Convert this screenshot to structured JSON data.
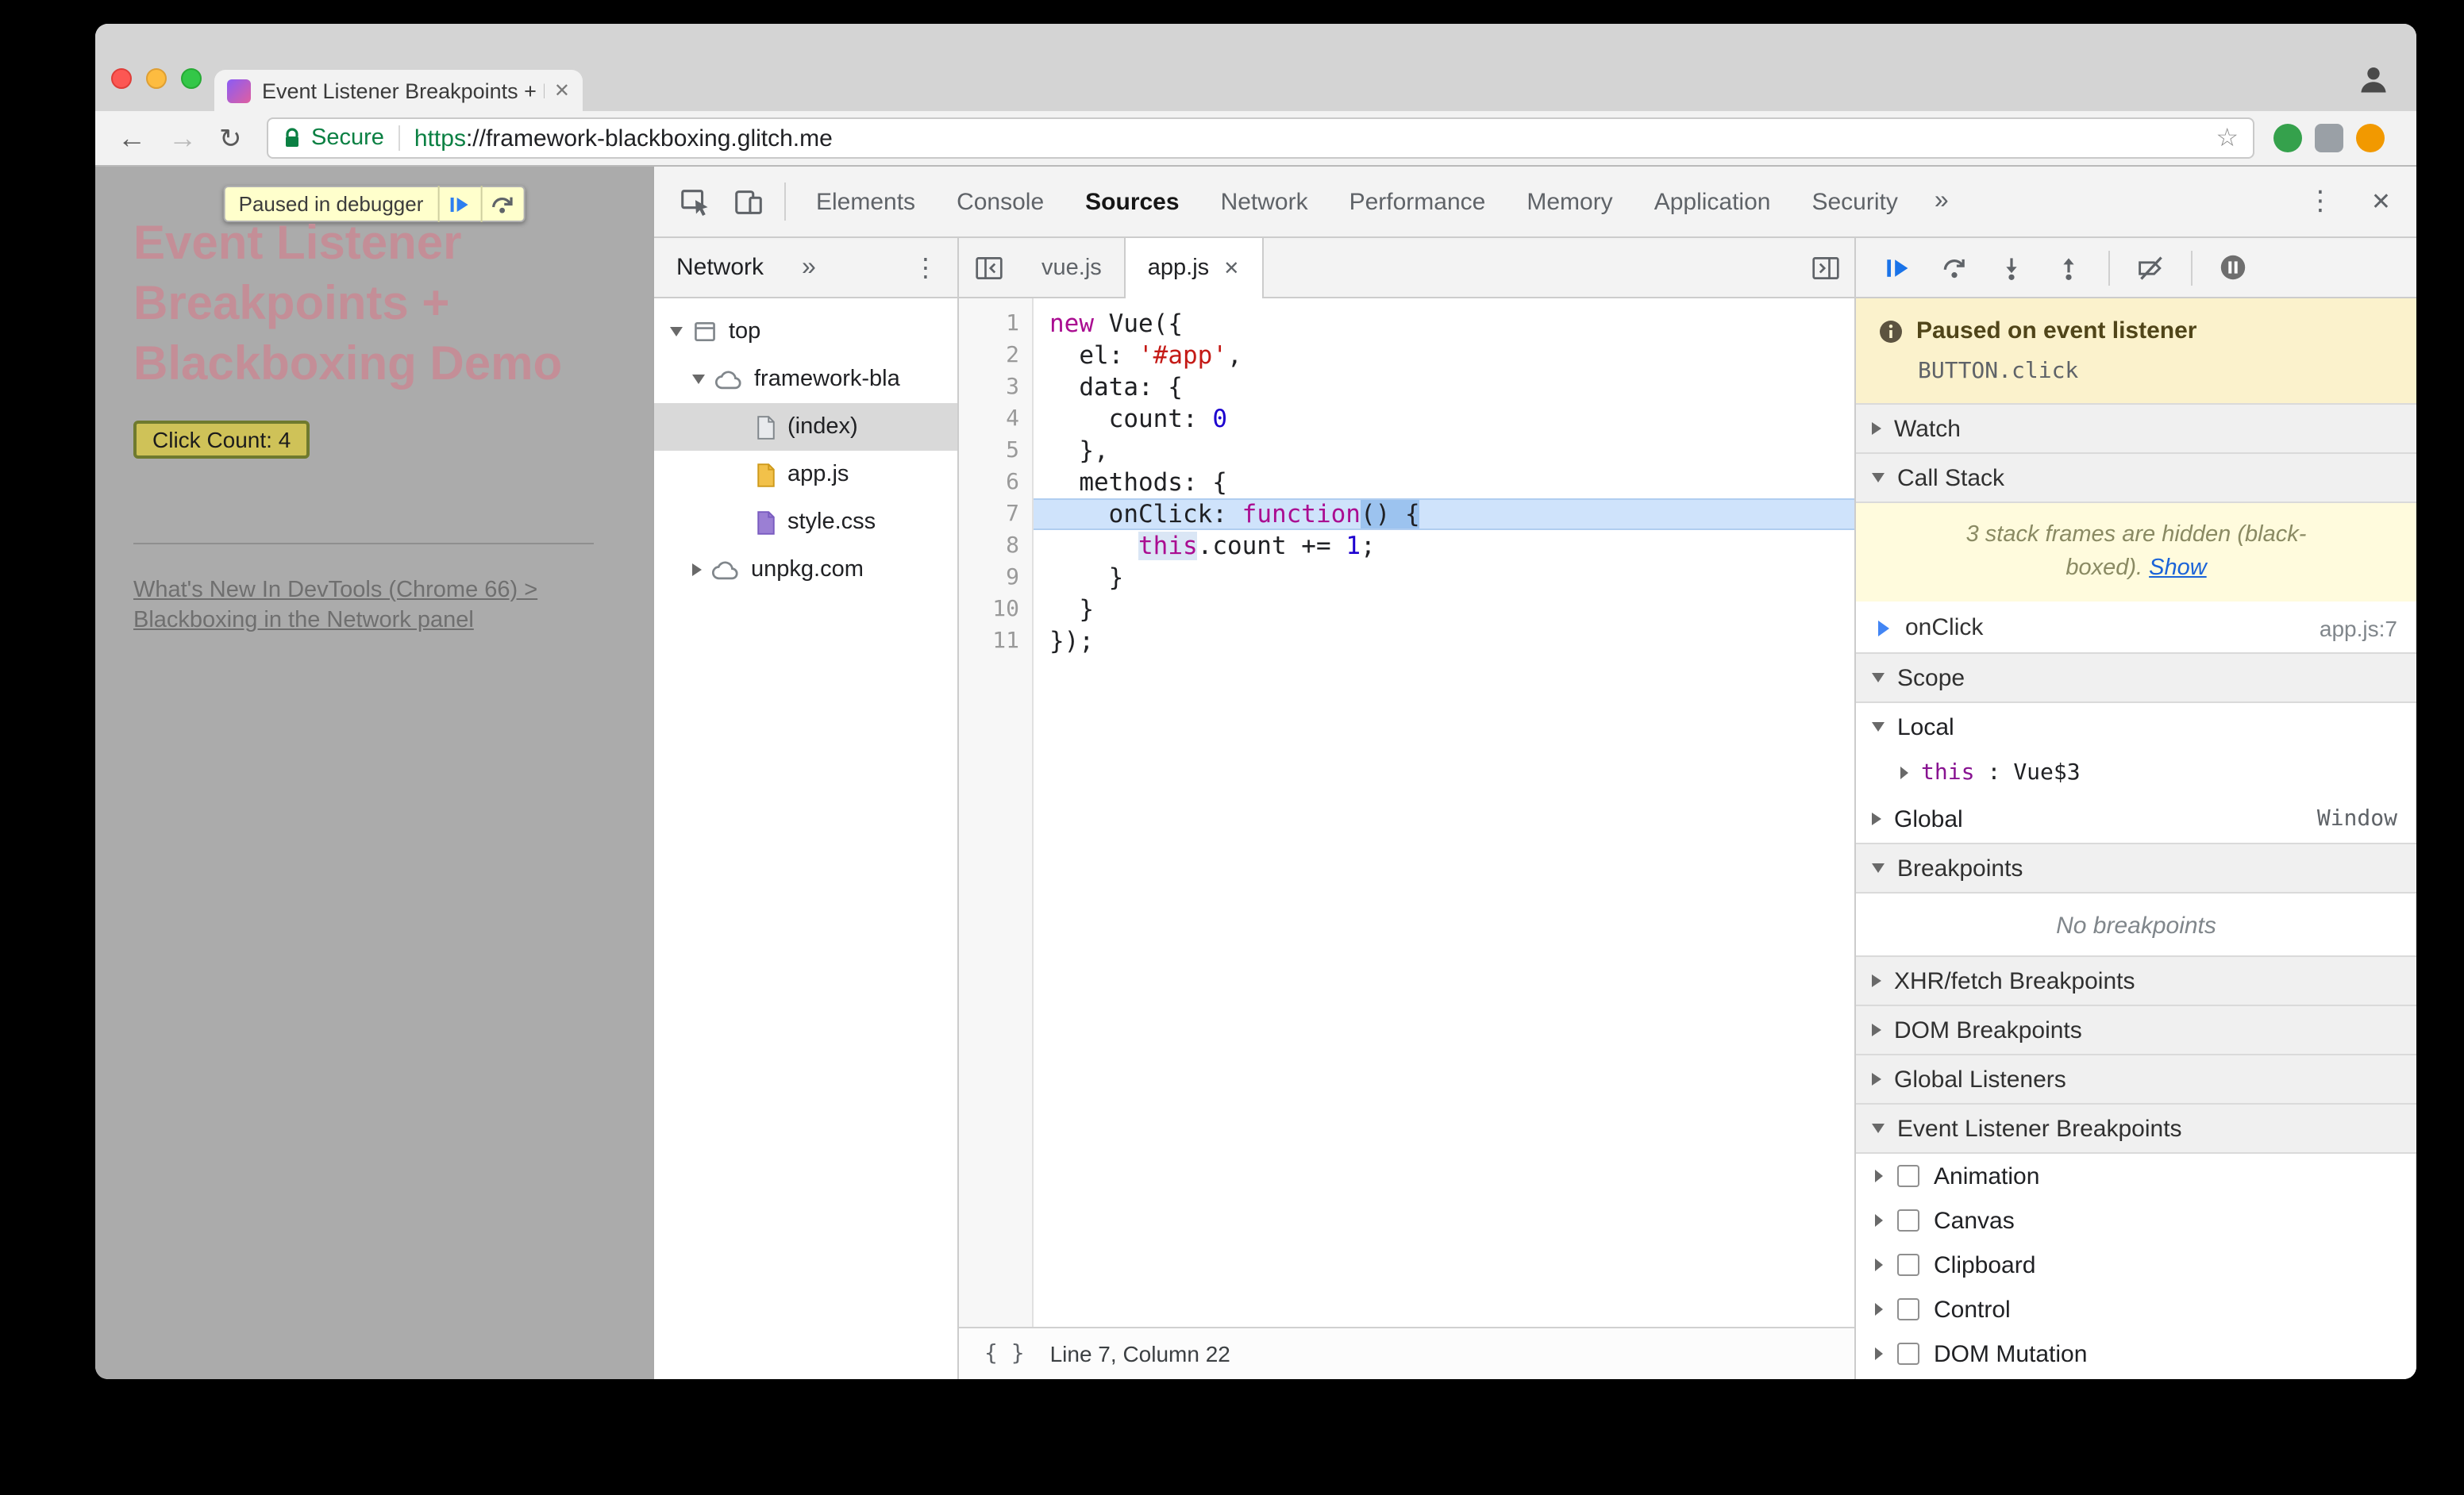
{
  "colors": {
    "accent_blue": "#1a73e8",
    "secure_green": "#0b8043",
    "paused_banner_yellow": "#fbf2cc",
    "execution_line_blue": "#cfe3fb",
    "heading_pink": "#c48e97",
    "page_dim_gray": "#ababab"
  },
  "icons": {
    "back": "←",
    "forward": "→",
    "reload": "↻",
    "star": "☆",
    "close": "✕",
    "kebab": "⋮",
    "more": "»",
    "braces": "{ }"
  },
  "browser": {
    "tab_title": "Event Listener Breakpoints + B",
    "secure_label": "Secure",
    "url_scheme": "https",
    "url_rest": "://framework-blackboxing.glitch.me"
  },
  "page": {
    "paused_badge_text": "Paused in debugger",
    "heading_line1": "Event Listener",
    "heading_line2": "Breakpoints +",
    "heading_line3": "Blackboxing Demo",
    "count_button": "Click Count: 4",
    "link_line1": "What's New In DevTools (Chrome 66) >",
    "link_line2": "Blackboxing in the Network panel"
  },
  "devtools": {
    "tabs": [
      "Elements",
      "Console",
      "Sources",
      "Network",
      "Performance",
      "Memory",
      "Application",
      "Security"
    ],
    "selected_tab": "Sources",
    "navigator": {
      "tab_label": "Network",
      "items": [
        {
          "label": "top"
        },
        {
          "label": "framework-bla"
        },
        {
          "label": "(index)"
        },
        {
          "label": "app.js"
        },
        {
          "label": "style.css"
        },
        {
          "label": "unpkg.com"
        }
      ]
    },
    "editor": {
      "tab_vue": "vue.js",
      "tab_app": "app.js",
      "status": "Line 7, Column 22",
      "paused_line": 7,
      "code_lines": [
        [
          {
            "t": "new",
            "c": "k"
          },
          {
            "t": " Vue({",
            "c": "p"
          }
        ],
        [
          {
            "t": "  el: ",
            "c": "p"
          },
          {
            "t": "'#app'",
            "c": "s"
          },
          {
            "t": ",",
            "c": "p"
          }
        ],
        [
          {
            "t": "  data: {",
            "c": "p"
          }
        ],
        [
          {
            "t": "    count: ",
            "c": "p"
          },
          {
            "t": "0",
            "c": "n"
          }
        ],
        [
          {
            "t": "  },",
            "c": "p"
          }
        ],
        [
          {
            "t": "  methods: {",
            "c": "p"
          }
        ],
        [
          {
            "t": "    onClick: ",
            "c": "p"
          },
          {
            "t": "function",
            "c": "k"
          },
          {
            "t": "() {",
            "c": "x"
          }
        ],
        [
          {
            "t": "      ",
            "c": "p"
          },
          {
            "t": "this",
            "c": "kh"
          },
          {
            "t": ".count += ",
            "c": "p"
          },
          {
            "t": "1",
            "c": "n"
          },
          {
            "t": ";",
            "c": "p"
          }
        ],
        [
          {
            "t": "    }",
            "c": "p"
          }
        ],
        [
          {
            "t": "  }",
            "c": "p"
          }
        ],
        [
          {
            "t": "});",
            "c": "p"
          }
        ]
      ]
    },
    "sidebar": {
      "banner_title": "Paused on event listener",
      "banner_detail": "BUTTON.click",
      "watch": "Watch",
      "call_stack": "Call Stack",
      "notice_line1": "3 stack frames are hidden (black-",
      "notice_line2_prefix": "boxed). ",
      "notice_link": "Show",
      "frame_name": "onClick",
      "frame_location": "app.js:7",
      "scope": "Scope",
      "scope_local": "Local",
      "scope_this_key": "this",
      "scope_this_sep": ": ",
      "scope_this_value": "Vue$3",
      "scope_global": "Global",
      "scope_global_value": "Window",
      "breakpoints": "Breakpoints",
      "no_breakpoints": "No breakpoints",
      "xhr": "XHR/fetch Breakpoints",
      "dom": "DOM Breakpoints",
      "global_listeners": "Global Listeners",
      "event_listener_breakpoints": "Event Listener Breakpoints",
      "cats": [
        "Animation",
        "Canvas",
        "Clipboard",
        "Control",
        "DOM Mutation"
      ]
    }
  }
}
